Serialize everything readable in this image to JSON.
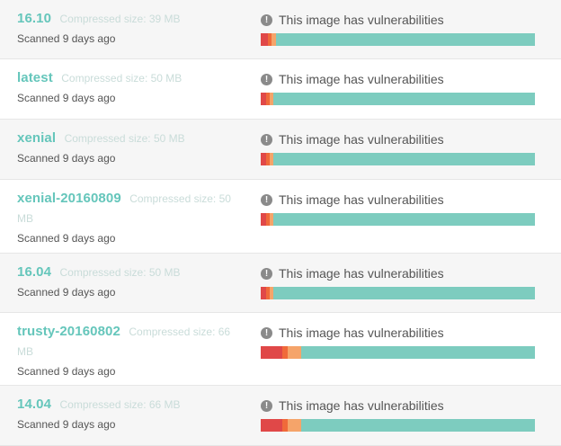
{
  "colors": {
    "critical": "#e04848",
    "high": "#f06a3a",
    "medium": "#f5a46a",
    "clean": "#7dccbf"
  },
  "images": [
    {
      "tag": "16.10",
      "size": "Compressed size: 39 MB",
      "scanned": "Scanned 9 days ago",
      "status": "This image has vulnerabilities",
      "vulns": {
        "critical": 0.025,
        "high": 0.012,
        "medium": 0.018
      },
      "row_height": 66,
      "shaded": true
    },
    {
      "tag": "latest",
      "size": "Compressed size: 50 MB",
      "scanned": "Scanned 9 days ago",
      "status": "This image has vulnerabilities",
      "vulns": {
        "critical": 0.02,
        "high": 0.012,
        "medium": 0.012
      },
      "row_height": 67,
      "shaded": false
    },
    {
      "tag": "xenial",
      "size": "Compressed size: 50 MB",
      "scanned": "Scanned 9 days ago",
      "status": "This image has vulnerabilities",
      "vulns": {
        "critical": 0.02,
        "high": 0.012,
        "medium": 0.012
      },
      "row_height": 67,
      "shaded": true
    },
    {
      "tag": "xenial-20160809",
      "size": "Compressed size: 50 MB",
      "scanned": "Scanned 9 days ago",
      "status": "This image has vulnerabilities",
      "vulns": {
        "critical": 0.02,
        "high": 0.012,
        "medium": 0.012
      },
      "row_height": 82,
      "shaded": false
    },
    {
      "tag": "16.04",
      "size": "Compressed size: 50 MB",
      "scanned": "Scanned 9 days ago",
      "status": "This image has vulnerabilities",
      "vulns": {
        "critical": 0.02,
        "high": 0.012,
        "medium": 0.012
      },
      "row_height": 66,
      "shaded": true
    },
    {
      "tag": "trusty-20160802",
      "size": "Compressed size: 66 MB",
      "scanned": "Scanned 9 days ago",
      "status": "This image has vulnerabilities",
      "vulns": {
        "critical": 0.08,
        "high": 0.02,
        "medium": 0.05
      },
      "row_height": 81,
      "shaded": false
    },
    {
      "tag": "14.04",
      "size": "Compressed size: 66 MB",
      "scanned": "Scanned 9 days ago",
      "status": "This image has vulnerabilities",
      "vulns": {
        "critical": 0.08,
        "high": 0.02,
        "medium": 0.05
      },
      "row_height": 67,
      "shaded": true
    }
  ]
}
